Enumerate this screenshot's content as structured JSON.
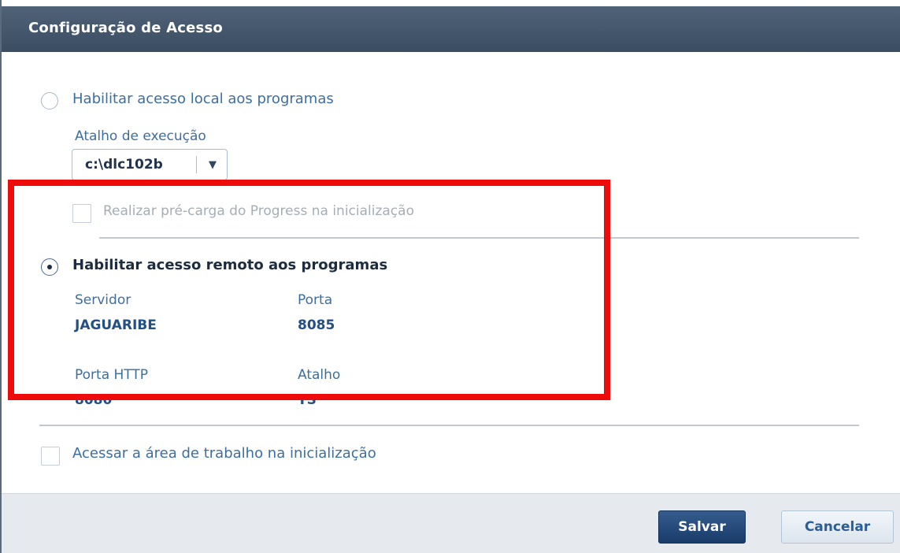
{
  "dialog": {
    "title": "Configuração de Acesso"
  },
  "local_access": {
    "label": "Habilitar acesso local aos programas",
    "selected": false,
    "shortcut_label": "Atalho de execução",
    "shortcut_value": "c:\\dlc102b",
    "preload_label": "Realizar pré-carga do Progress na inicialização",
    "preload_checked": false,
    "preload_enabled": false
  },
  "remote_access": {
    "label": "Habilitar acesso remoto aos programas",
    "selected": true,
    "server_label": "Servidor",
    "server_value": "JAGUARIBE",
    "port_label": "Porta",
    "port_value": "8085",
    "http_port_label": "Porta HTTP",
    "http_port_value": "8080",
    "shortcut_label": "Atalho",
    "shortcut_value": "TS"
  },
  "workspace": {
    "label": "Acessar a área de trabalho na inicialização",
    "checked": false
  },
  "footer": {
    "save_label": "Salvar",
    "cancel_label": "Cancelar"
  },
  "icons": {
    "dropdown": "chevron-down-icon"
  },
  "colors": {
    "title_bar": "#45586d",
    "highlight": "#ee0b0b",
    "save_button": "#1f4474",
    "link_text": "#3d6ea0"
  }
}
